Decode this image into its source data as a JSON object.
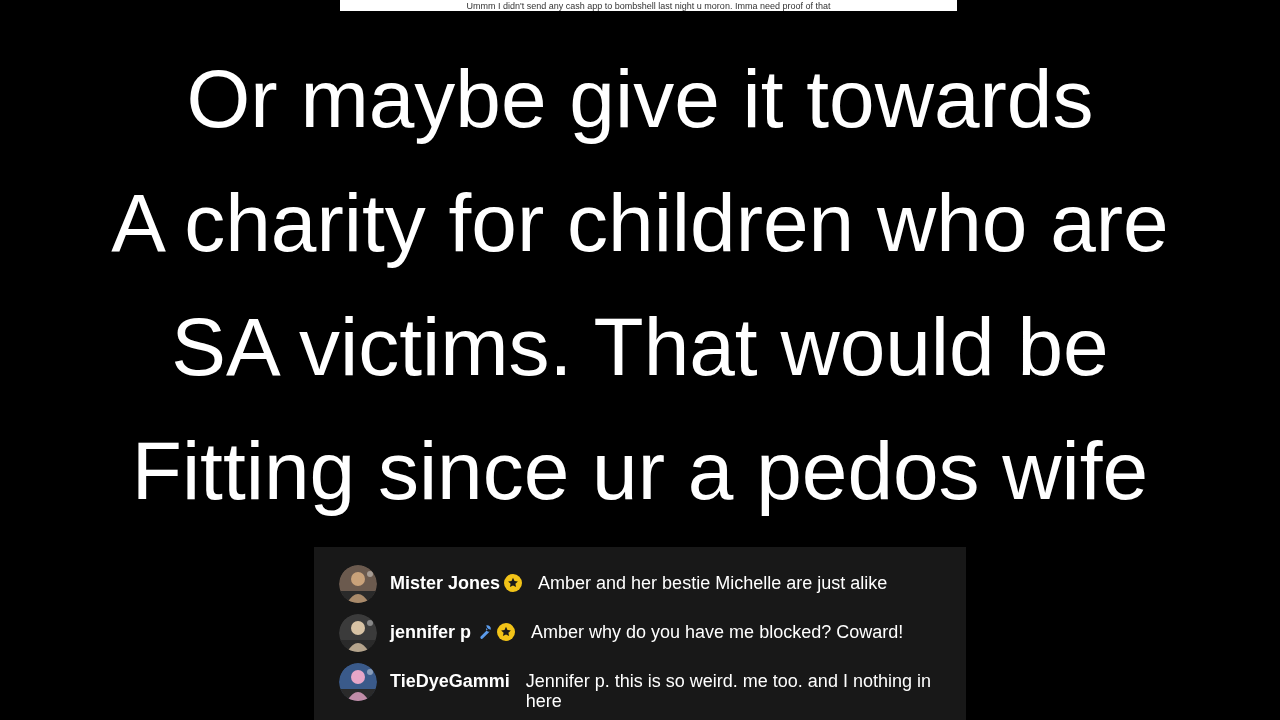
{
  "top_caption": "Ummm I didn't send any cash app to bombshell last night u moron. Imma need proof of that",
  "overlay_lines": [
    "Or maybe give it towards",
    "A charity for children who are",
    "SA victims. That would be",
    "Fitting since ur a pedos wife"
  ],
  "chat": {
    "messages": [
      {
        "name": "Mister Jones",
        "wrench": false,
        "star": true,
        "text": "Amber and her bestie Michelle are just alike"
      },
      {
        "name": "jennifer p",
        "wrench": true,
        "star": true,
        "text": "Amber why do you have me blocked? Coward!"
      },
      {
        "name": "TieDyeGammi",
        "wrench": false,
        "star": false,
        "text": "Jennifer p. this is so weird. me too. and I nothing in here"
      }
    ]
  }
}
